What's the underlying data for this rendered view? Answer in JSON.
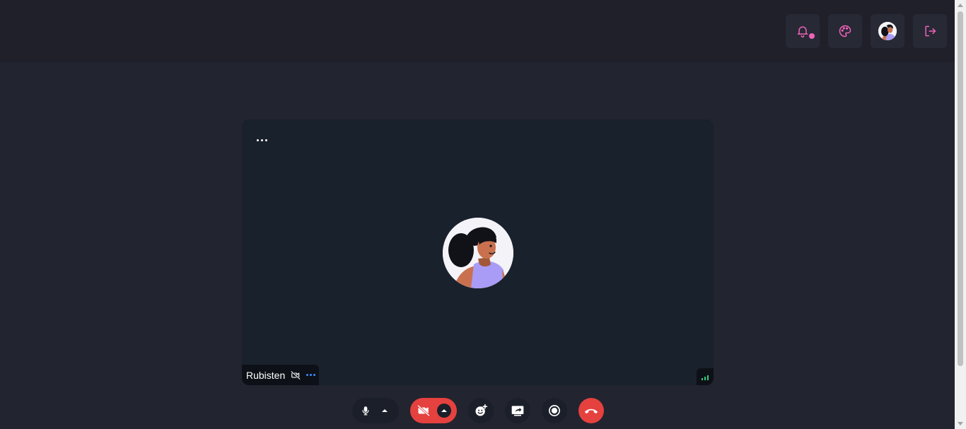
{
  "topbar": {
    "buttons": [
      {
        "icon": "bell-icon",
        "has_notification": true
      },
      {
        "icon": "palette-icon"
      },
      {
        "icon": "user-avatar-icon"
      },
      {
        "icon": "logout-icon"
      }
    ]
  },
  "participant": {
    "name": "Rubisten",
    "camera": "off",
    "signal_bars": 3
  },
  "controls": [
    {
      "icon": "microphone-icon",
      "has_caret": true
    },
    {
      "icon": "video-off-icon",
      "has_caret": true,
      "state": "off"
    },
    {
      "icon": "emoji-add-icon"
    },
    {
      "icon": "screen-share-icon"
    },
    {
      "icon": "record-icon"
    },
    {
      "icon": "hang-up-icon"
    }
  ],
  "colors": {
    "accent_pink": "#f062b8",
    "danger_red": "#e5413f",
    "signal_green": "#2fcf7d",
    "link_blue": "#3e8bff"
  }
}
